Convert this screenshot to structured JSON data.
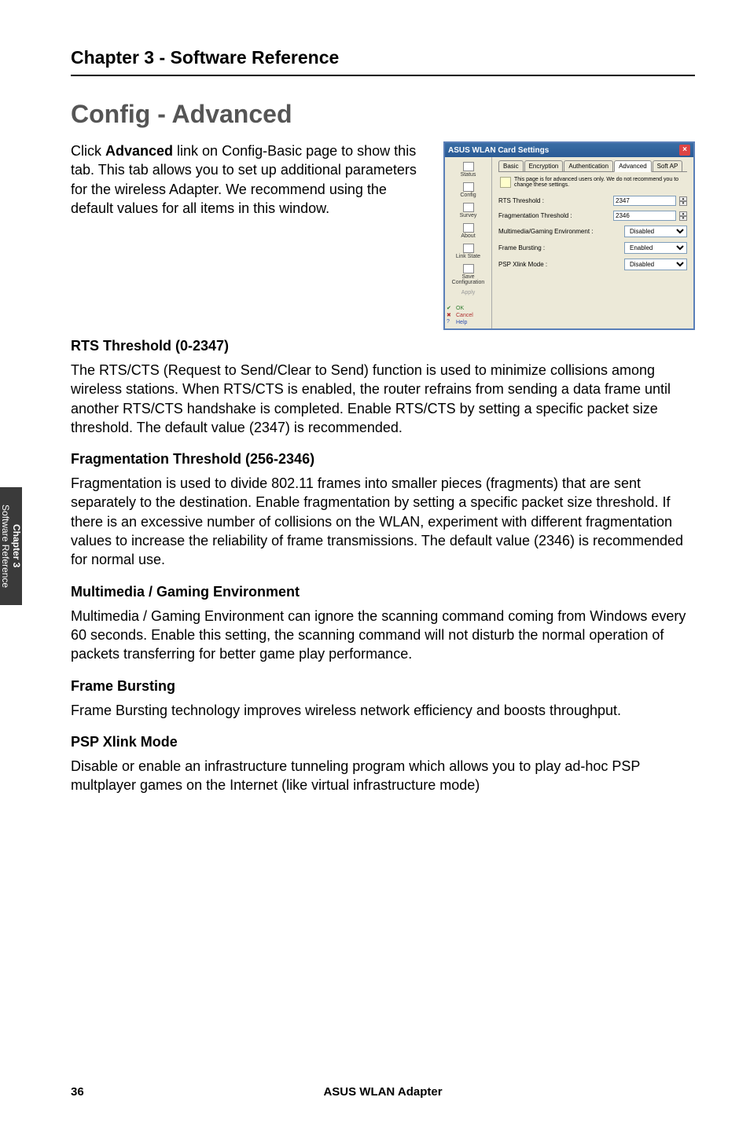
{
  "sidebar_tab": {
    "chapter_label": "Chapter 3",
    "section_label": "Software Reference"
  },
  "chapter_header": "Chapter 3 - Software Reference",
  "page_title": "Config - Advanced",
  "intro_prefix": "Click ",
  "intro_bold": "Advanced",
  "intro_suffix": " link on Config-Basic page to show this tab. This tab allows you to set up additional parameters for the wireless Adapter. We recommend using the default values for all items in this window.",
  "panel": {
    "title": "ASUS WLAN Card Settings",
    "close": "×",
    "sidebar_items": [
      "Status",
      "Config",
      "Survey",
      "About",
      "Link State"
    ],
    "sidebar_lower": [
      "Save Configuration",
      "Apply"
    ],
    "bottom_links": {
      "ok": "OK",
      "cancel": "Cancel",
      "help": "Help"
    },
    "tabs": [
      "Basic",
      "Encryption",
      "Authentication",
      "Advanced",
      "Soft AP"
    ],
    "hint": "This page is for advanced users only. We do not recommend you to change these settings.",
    "fields": [
      {
        "label": "RTS Threshold :",
        "value": "2347",
        "type": "spin"
      },
      {
        "label": "Fragmentation Threshold :",
        "value": "2346",
        "type": "spin"
      },
      {
        "label": "Multimedia/Gaming Environment :",
        "value": "Disabled",
        "type": "select"
      },
      {
        "label": "Frame Bursting :",
        "value": "Enabled",
        "type": "select"
      },
      {
        "label": "PSP Xlink Mode :",
        "value": "Disabled",
        "type": "select"
      }
    ]
  },
  "sections": [
    {
      "heading": "RTS Threshold (0-2347)",
      "text": "The RTS/CTS (Request to Send/Clear to Send) function is used to minimize collisions among wireless stations. When RTS/CTS is enabled, the router refrains from sending a data frame until another RTS/CTS handshake is completed. Enable RTS/CTS by setting a specific packet size threshold. The default value (2347) is recommended."
    },
    {
      "heading": "Fragmentation Threshold (256-2346)",
      "text": "Fragmentation is used to divide 802.11 frames into smaller pieces (fragments) that are sent separately to the destination. Enable fragmentation by setting a specific packet size threshold. If there is an excessive number of collisions on the WLAN, experiment with different fragmentation values to increase the reliability of frame transmissions. The default value (2346) is recommended for normal use."
    },
    {
      "heading": "Multimedia / Gaming Environment",
      "text": "Multimedia / Gaming Environment can ignore the scanning command coming from Windows every 60 seconds. Enable this setting, the scanning command will not disturb the normal operation of packets transferring for better game play performance."
    },
    {
      "heading": "Frame Bursting",
      "text": "Frame Bursting technology improves wireless network efficiency and boosts throughput."
    },
    {
      "heading": "PSP Xlink Mode",
      "text": "Disable or enable an infrastructure tunneling program which allows you to play ad-hoc PSP multplayer games on the Internet (like virtual infrastructure mode)"
    }
  ],
  "footer": {
    "page_num": "36",
    "product": "ASUS WLAN Adapter"
  }
}
